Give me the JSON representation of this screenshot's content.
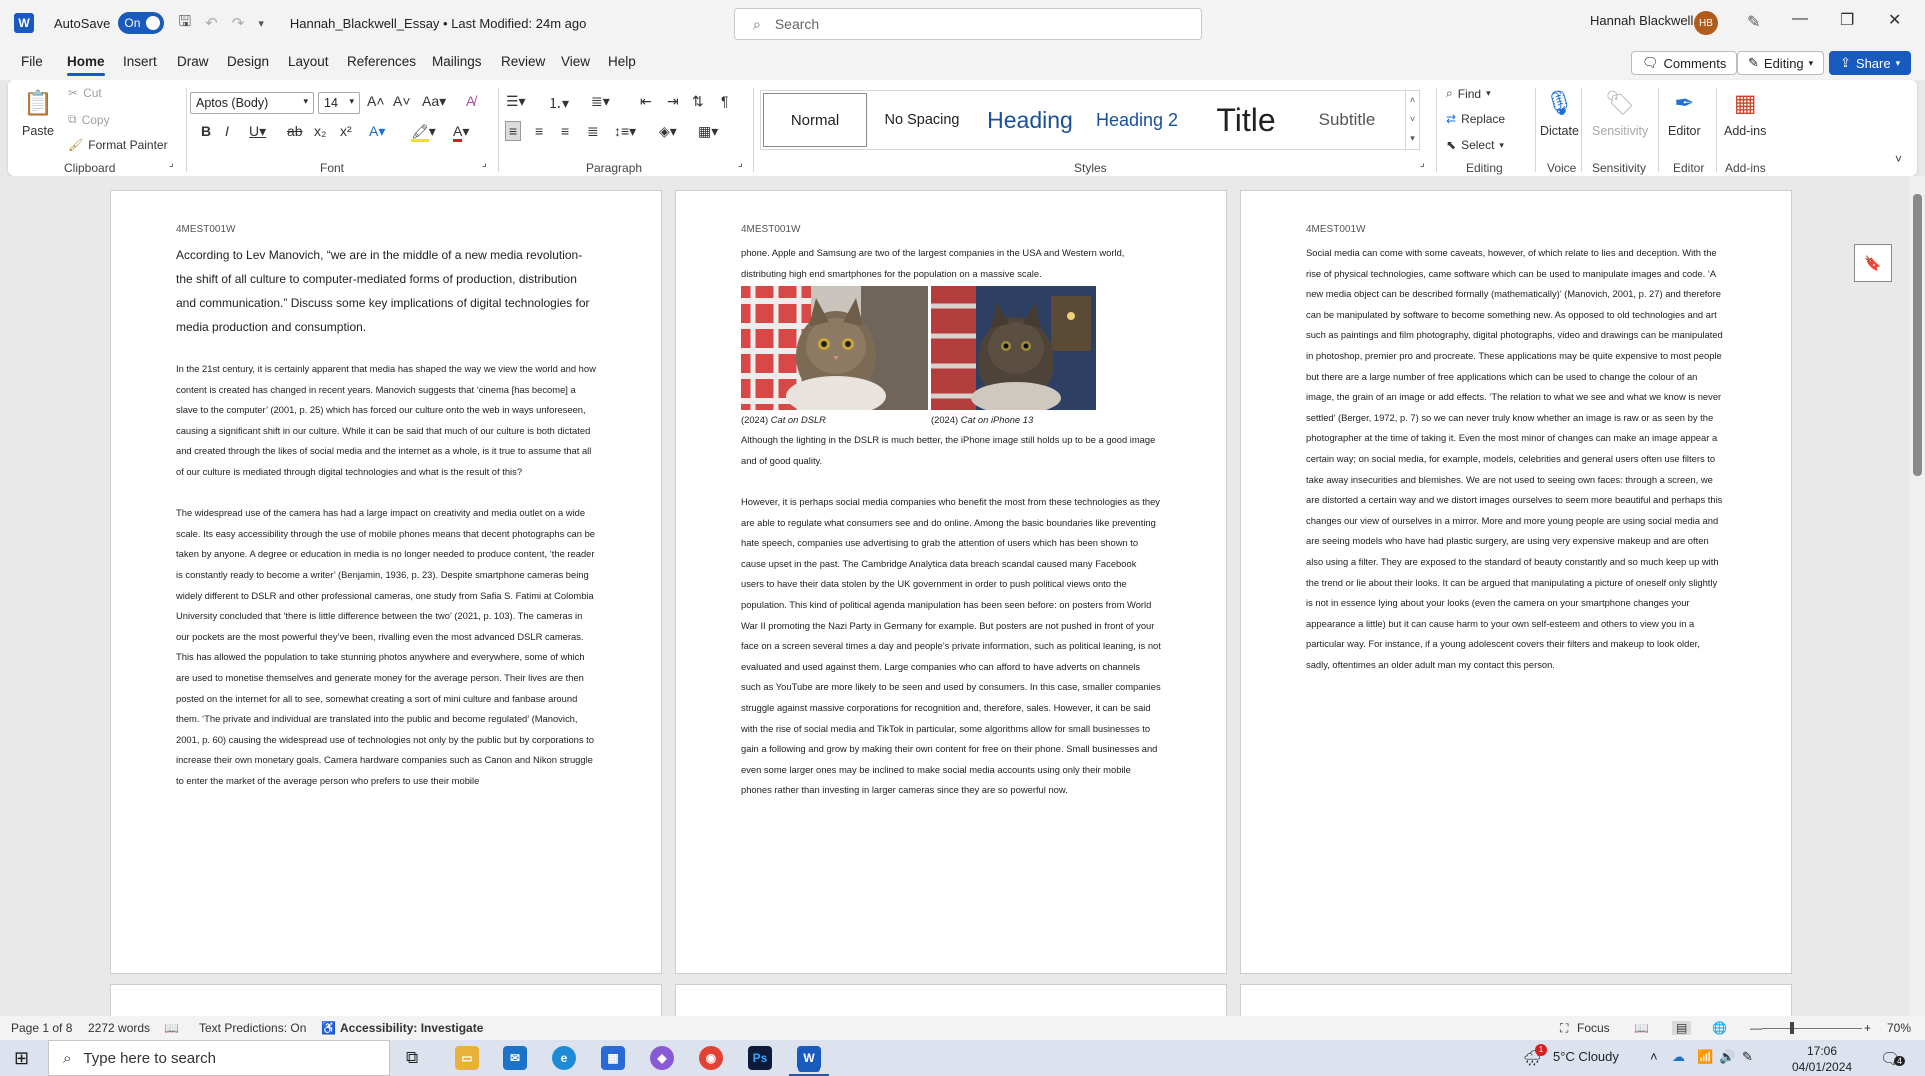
{
  "titlebar": {
    "app_letter": "W",
    "autosave_label": "AutoSave",
    "autosave_state": "On",
    "doc_title": "Hannah_Blackwell_Essay • Last Modified: 24m ago",
    "search_placeholder": "Search",
    "user_name": "Hannah Blackwell",
    "user_initials": "HB",
    "minimize": "—",
    "restore": "❐",
    "close": "✕"
  },
  "tabs": [
    "File",
    "Home",
    "Insert",
    "Draw",
    "Design",
    "Layout",
    "References",
    "Mailings",
    "Review",
    "View",
    "Help"
  ],
  "tab_actions": {
    "comments": "Comments",
    "editing": "Editing",
    "share": "Share"
  },
  "ribbon": {
    "clipboard": {
      "paste": "Paste",
      "cut": "Cut",
      "copy": "Copy",
      "format_painter": "Format Painter",
      "label": "Clipboard"
    },
    "font": {
      "name": "Aptos (Body)",
      "size": "14",
      "label": "Font"
    },
    "paragraph": {
      "label": "Paragraph"
    },
    "styles": {
      "items": [
        "Normal",
        "No Spacing",
        "Heading",
        "Heading 2",
        "Title",
        "Subtitle"
      ],
      "label": "Styles"
    },
    "editing": {
      "find": "Find",
      "replace": "Replace",
      "select": "Select",
      "label": "Editing"
    },
    "voice": {
      "dictate": "Dictate",
      "label": "Voice"
    },
    "sensitivity": {
      "button": "Sensitivity",
      "label": "Sensitivity"
    },
    "editor": {
      "button": "Editor",
      "label": "Editor"
    },
    "addins": {
      "button": "Add-ins",
      "label": "Add-ins"
    }
  },
  "pages": {
    "header": "4MEST001W",
    "p1_title": "According to Lev Manovich, “we are in the middle of a new media revolution- the shift of all culture to computer-mediated forms of production, distribution and communication.” Discuss some key implications of digital technologies for media production and consumption.",
    "p1_para1": "In the 21st century, it is certainly apparent that media has shaped the way we view the world and how content is created has changed in recent years. Manovich suggests that ‘cinema [has become] a slave to the computer’ (2001, p. 25) which has forced our culture onto the web in ways unforeseen, causing a significant shift in our culture. While it can be said that much of our culture is both dictated and created through the likes of social media and the internet as a whole, is it true to assume that all of our culture is mediated through digital technologies and what is the result of this?",
    "p1_para2": "The widespread use of the camera has had a large impact on creativity and media outlet on a wide scale. Its easy accessibility through the use of mobile phones means that decent photographs can be taken by anyone. A degree or education in media is no longer needed to produce content, ‘the reader is constantly ready to become a writer’ (Benjamin, 1936, p. 23). Despite smartphone cameras being widely different to DSLR and other professional cameras, one study from Safia S. Fatimi at Colombia University concluded that ‘there is little difference between the two’ (2021, p. 103). The cameras in our pockets are the most powerful they’ve been, rivalling even the most advanced DSLR cameras. This has allowed the population to take stunning photos anywhere and everywhere, some of which are used to monetise themselves and generate money for the average person. Their lives are then posted on the internet for all to see, somewhat creating a sort of mini culture and fanbase around them. ‘The private and individual are translated into the public and become regulated’ (Manovich, 2001, p. 60) causing the widespread use of technologies not only by the public but by corporations to increase their own monetary goals. Camera hardware companies such as Canon and Nikon struggle to enter the market of the average person who prefers to use their mobile",
    "p2_intro": "phone. Apple and Samsung are two of the largest companies in the USA and Western world, distributing high end smartphones for the population on a massive scale.",
    "p2_caption1_year": "(2024)",
    "p2_caption1_title": "Cat on DSLR",
    "p2_caption2_year": "(2024)",
    "p2_caption2_title": "Cat on iPhone 13",
    "p2_after": "Although the lighting in the DSLR is much better, the iPhone image still holds up to be a good image and of good quality.",
    "p2_para": "However, it is perhaps social media companies who benefit the most from these technologies as they are able to regulate what consumers see and do online. Among the basic boundaries like preventing hate speech, companies use advertising to grab the attention of users which has been shown to cause upset in the past. The Cambridge Analytica data breach scandal caused many Facebook users to have their data stolen by the UK government in order to push political views onto the population. This kind of political agenda manipulation has been seen before: on posters from World War II promoting the Nazi Party in Germany for example. But posters are not pushed in front of your face on a screen several times a day and people’s private information, such as political leaning, is not evaluated and used against them. Large companies who can afford to have adverts on channels such as YouTube are more likely to be seen and used by consumers. In this case, smaller companies struggle against massive corporations for recognition and, therefore, sales. However, it can be said with the rise of social media and TikTok in particular, some algorithms allow for small businesses to gain a following and grow by making their own content for free on their phone. Small businesses and even some larger ones may be inclined to make social media accounts using only their mobile phones rather than investing in larger cameras since they are so powerful now.",
    "p3_para": "Social media can come with some caveats, however, of which relate to lies and deception. With the rise of physical technologies, came software which can be used to manipulate images and code. ‘A new media object can be described formally (mathematically)’ (Manovich, 2001, p. 27) and therefore can be manipulated by software to become something new. As opposed to old technologies and art such as paintings and film photography, digital photographs, video and drawings can be manipulated in photoshop, premier pro and procreate. These applications may be quite expensive to most people but there are a large number of free applications which can be used to change the colour of an image, the grain of an image or add effects. ‘The relation to what we see and what we know is never settled’ (Berger, 1972, p. 7) so we can never truly know whether an image is raw or as seen by the photographer at the time of taking it. Even the most minor of changes can make an image appear a certain way; on social media, for example, models, celebrities and general users often use filters to take away insecurities and blemishes. We are not used to seeing own faces: through a screen, we are distorted a certain way and we distort images ourselves to seem more beautiful and perhaps this changes our view of ourselves in a mirror. More and more young people are using social media and are seeing models who have had plastic surgery, are using very expensive makeup and are often also using a filter. They are exposed to the standard of beauty constantly and so much keep up with the trend or lie about their looks. It can be argued that manipulating a picture of oneself only slightly is not in essence lying about your looks (even the camera on your smartphone changes your appearance a little) but it can cause harm to your own self-esteem and others to view you in a particular way. For instance, if a young adolescent covers their filters and makeup to look older, sadly, oftentimes an older adult man my contact this person."
  },
  "statusbar": {
    "page": "Page 1 of 8",
    "words": "2272 words",
    "predictions": "Text Predictions: On",
    "accessibility": "Accessibility: Investigate",
    "focus": "Focus",
    "zoom": "70%"
  },
  "taskbar": {
    "search_placeholder": "Type here to search",
    "weather": "5°C  Cloudy",
    "time": "17:06",
    "date": "04/01/2024",
    "notification_count": "4",
    "weather_badge": "1"
  }
}
